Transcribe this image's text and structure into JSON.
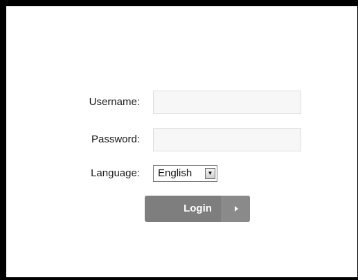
{
  "form": {
    "username_label": "Username:",
    "username_value": "",
    "password_label": "Password:",
    "password_value": "",
    "language_label": "Language:",
    "language_selected": "English",
    "login_label": "Login"
  },
  "icons": {
    "dropdown": "chevron-down-icon",
    "login_arrow": "arrow-right-icon"
  },
  "colors": {
    "border": "#000000",
    "button": "#7e7e7e",
    "field_bg": "#f7f7f7"
  }
}
